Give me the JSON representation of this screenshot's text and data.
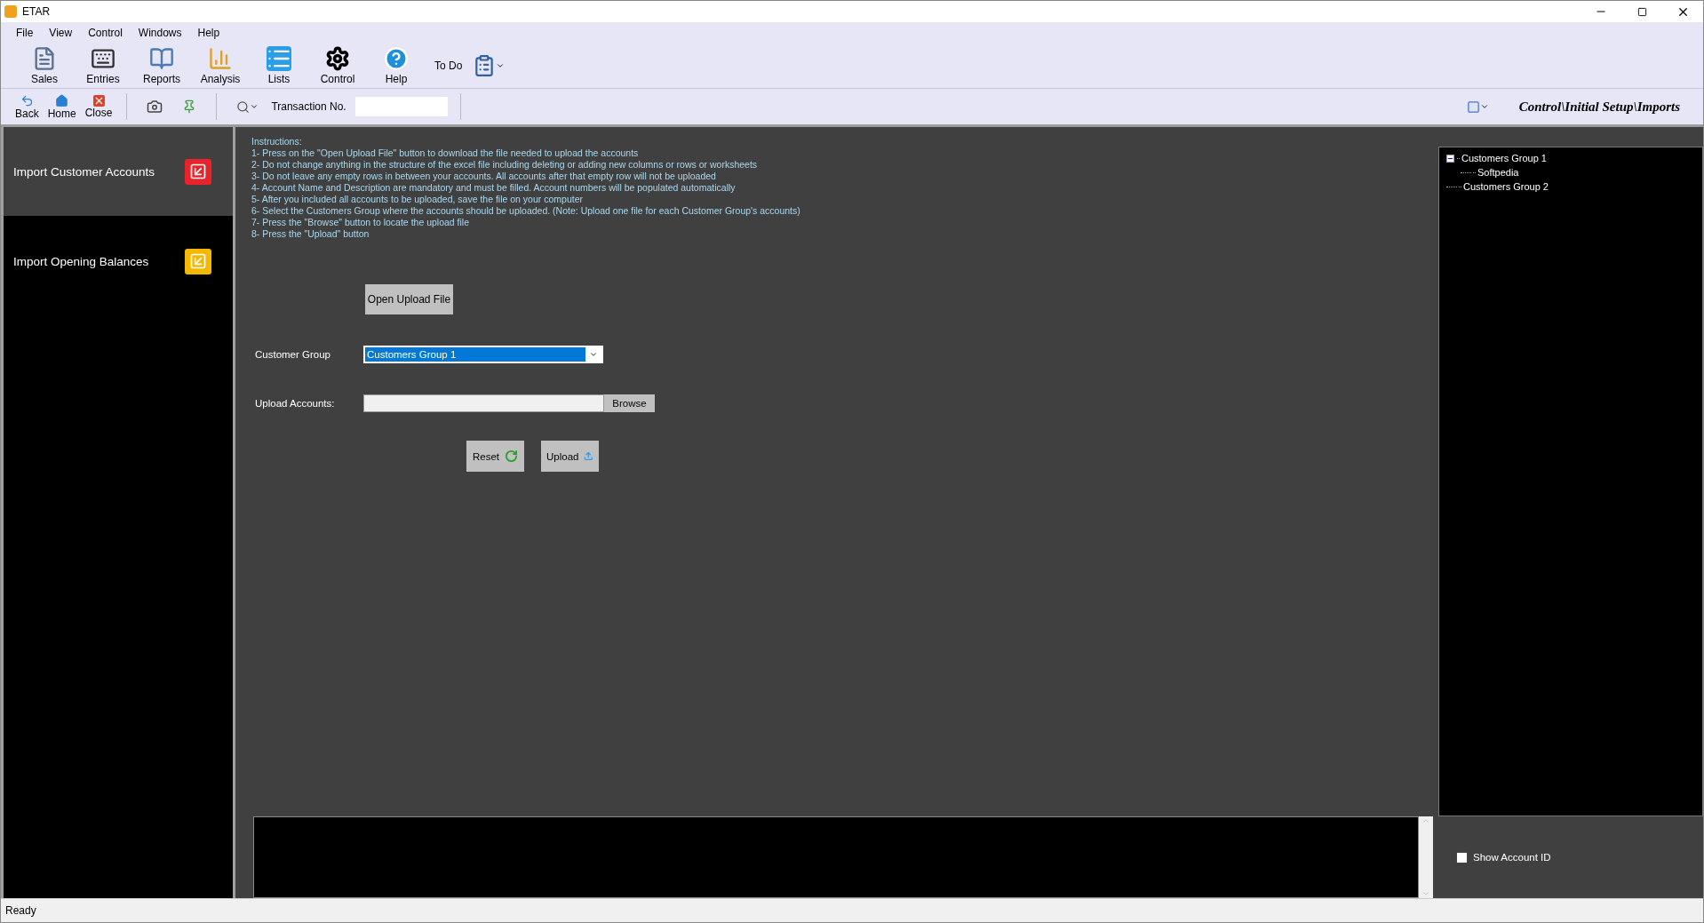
{
  "window": {
    "title": "ETAR"
  },
  "menu": [
    "File",
    "View",
    "Control",
    "Windows",
    "Help"
  ],
  "toolbar": [
    {
      "label": "Sales",
      "kind": "sales"
    },
    {
      "label": "Entries",
      "kind": "entries"
    },
    {
      "label": "Reports",
      "kind": "reports"
    },
    {
      "label": "Analysis",
      "kind": "analysis"
    },
    {
      "label": "Lists",
      "kind": "lists"
    },
    {
      "label": "Control",
      "kind": "control"
    },
    {
      "label": "Help",
      "kind": "help"
    }
  ],
  "todo": {
    "label": "To Do"
  },
  "nav_toolbar": [
    {
      "label": "Back",
      "kind": "back"
    },
    {
      "label": "Home",
      "kind": "home"
    },
    {
      "label": "Close",
      "kind": "close"
    }
  ],
  "transaction": {
    "label": "Transaction No."
  },
  "breadcrumb": "Control\\Initial Setup\\Imports",
  "sidebar": {
    "items": [
      {
        "label": "Import Customer Accounts",
        "selected": true,
        "color": "#e8232a"
      },
      {
        "label": "Import Opening Balances",
        "selected": false,
        "color": "#f5b800"
      }
    ]
  },
  "instructions": [
    "Instructions:",
    "1- Press on the \"Open Upload File\" button to download the file needed to upload the accounts",
    "2- Do not change anything in the structure of the excel file including deleting or adding new columns or rows or worksheets",
    "3- Do not leave any empty rows in between your accounts. All accounts after that empty row will not be uploaded",
    "4- Account Name and Description are mandatory and must be filled. Account numbers will be populated automatically",
    "5- After you included all accounts to be uploaded, save the file on your computer",
    "6- Select the Customers Group where the accounts should be uploaded. (Note: Upload one file for each Customer Group's accounts)",
    "7- Press the \"Browse\" button to locate the upload file",
    "8- Press the \"Upload\" button"
  ],
  "open_button": "Open Upload File",
  "customer_group": {
    "label": "Customer Group",
    "value": "Customers Group 1"
  },
  "upload_accounts": {
    "label": "Upload Accounts:",
    "browse": "Browse"
  },
  "actions": [
    {
      "label": "Reset",
      "kind": "reset"
    },
    {
      "label": "Upload",
      "kind": "upload"
    }
  ],
  "tree": [
    {
      "label": "Customers Group 1",
      "expanded": true,
      "children": [
        {
          "label": "Softpedia"
        }
      ]
    },
    {
      "label": "Customers Group 2"
    }
  ],
  "show_account_id": {
    "label": "Show Account ID",
    "checked": false
  },
  "status_bar": "Ready"
}
